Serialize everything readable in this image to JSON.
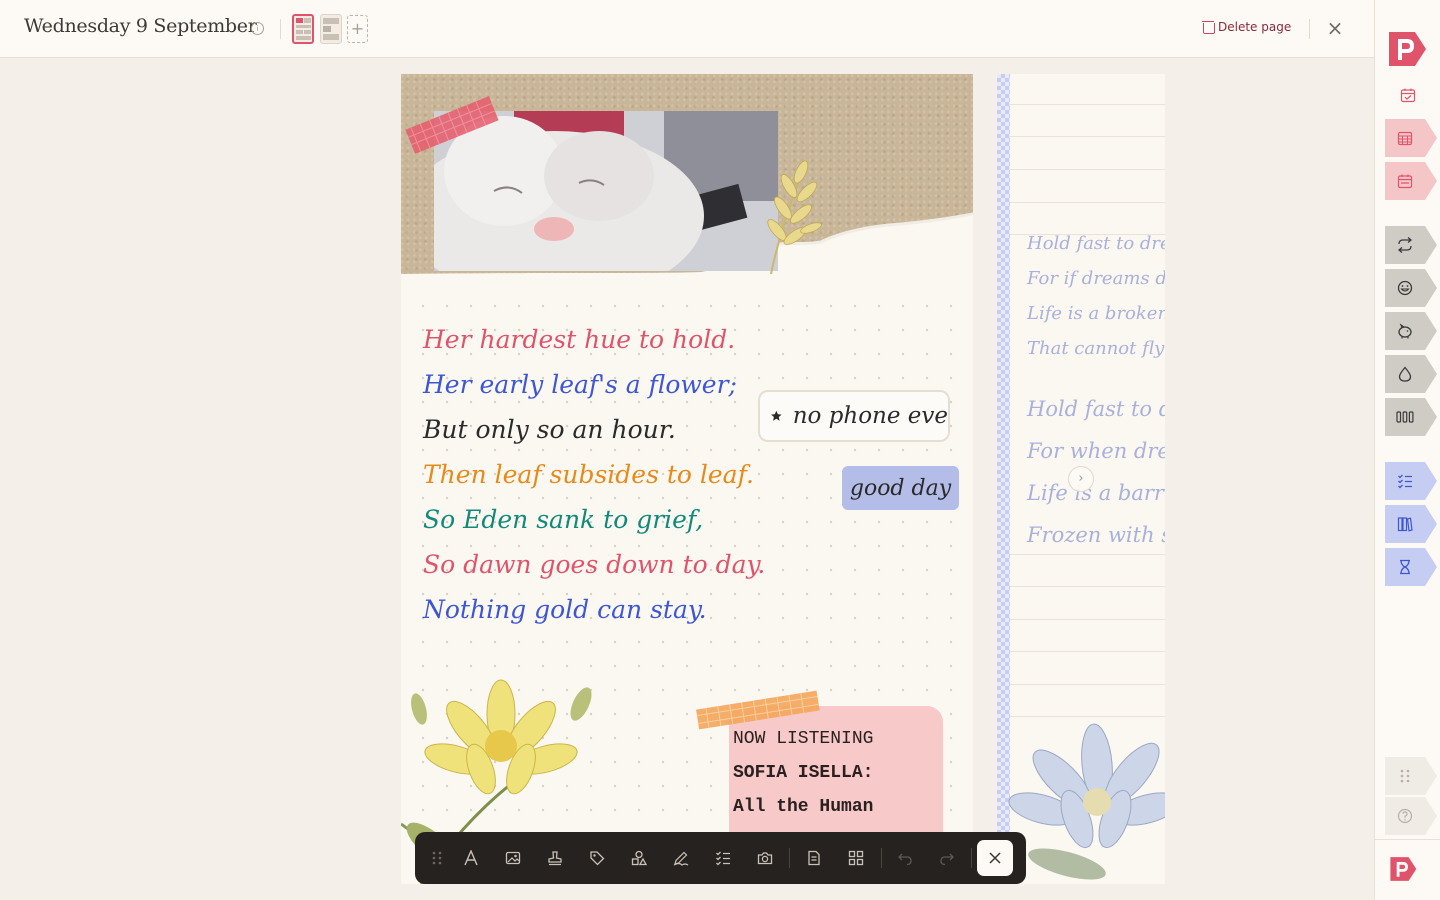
{
  "header": {
    "date_title": "Wednesday 9 September",
    "info_icon": "info-icon",
    "delete_label": "Delete page",
    "add_page_symbol": "+",
    "close_symbol": "×"
  },
  "poem": {
    "lines": [
      {
        "text": "Her hardest hue to hold.",
        "color": "#e0546b"
      },
      {
        "text": "Her early leaf's a flower;",
        "color": "#3d56d4"
      },
      {
        "text": "But only so an hour.",
        "color": "#2b2b2b"
      },
      {
        "text": "Then leaf subsides to leaf.",
        "color": "#e88a1a"
      },
      {
        "text": "So Eden sank to grief,",
        "color": "#128a7a"
      },
      {
        "text": "So dawn goes down to day.",
        "color": "#e0546b"
      },
      {
        "text": "Nothing gold can stay.",
        "color": "#3d56d4"
      }
    ]
  },
  "stickers": {
    "phone_text": "no phone eve",
    "good_day_text": "good day"
  },
  "now_listening": {
    "heading": "NOW LISTENING",
    "artist": "SOFIA ISELLA:",
    "title": "All the Human"
  },
  "next_page": {
    "verse1": [
      "Hold fast to drea",
      "For if dreams die",
      "Life is a broken-w",
      "That cannot fly"
    ],
    "verse2": [
      "Hold fast to dr",
      "For when drea",
      "Life is a barre",
      "Frozen with sn"
    ],
    "next_symbol": "›"
  },
  "sidebar": {
    "tabs": [
      {
        "name": "daily-tab",
        "icon": "calendar-check-icon",
        "color": "#fdfaf5"
      },
      {
        "name": "monthly-tab",
        "icon": "calendar-grid-icon",
        "color": "#f5c6c8"
      },
      {
        "name": "weekly-tab",
        "icon": "calendar-week-icon",
        "color": "#f5c6c8"
      },
      {
        "name": "habit-tab",
        "icon": "repeat-icon",
        "color": "#cfcbc5"
      },
      {
        "name": "mood-tab",
        "icon": "smile-icon",
        "color": "#cfcbc5"
      },
      {
        "name": "fitness-tab",
        "icon": "piggy-icon",
        "color": "#cfcbc5"
      },
      {
        "name": "water-tab",
        "icon": "drop-icon",
        "color": "#cfcbc5"
      },
      {
        "name": "tracker-tab",
        "icon": "bars-icon",
        "color": "#cfcbc5"
      },
      {
        "name": "todo-tab",
        "icon": "checklist-icon",
        "color": "#c6cdf3"
      },
      {
        "name": "books-tab",
        "icon": "books-icon",
        "color": "#c6cdf3"
      },
      {
        "name": "timer-tab",
        "icon": "hourglass-icon",
        "color": "#c6cdf3"
      },
      {
        "name": "grid-tab",
        "icon": "dots-grid-icon",
        "color": "#efebe5"
      },
      {
        "name": "help-tab",
        "icon": "help-icon",
        "color": "#efebe5"
      }
    ],
    "brand_color": "#e0546b"
  },
  "toolbar": {
    "tools": [
      "drag-handle-icon",
      "text-icon",
      "image-icon",
      "stamp-icon",
      "tag-icon",
      "shapes-icon",
      "pen-icon",
      "checklist-icon",
      "camera-icon",
      "page-icon",
      "layout-icon",
      "undo-icon",
      "redo-icon"
    ],
    "close_symbol": "×"
  }
}
